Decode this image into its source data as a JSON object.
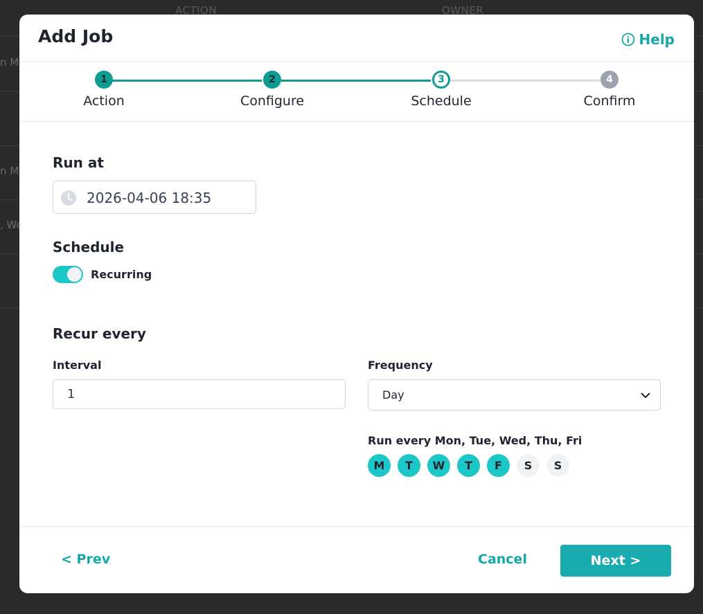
{
  "background": {
    "columns": [
      "ACTION",
      "OWNER"
    ],
    "row_fragments": [
      "n M",
      "",
      "n M",
      ", We"
    ]
  },
  "modal": {
    "title": "Add Job",
    "help_label": "Help",
    "help_icon": "info-circle-icon"
  },
  "stepper": {
    "steps": [
      {
        "number": "1",
        "label": "Action",
        "state": "done"
      },
      {
        "number": "2",
        "label": "Configure",
        "state": "done"
      },
      {
        "number": "3",
        "label": "Schedule",
        "state": "current"
      },
      {
        "number": "4",
        "label": "Confirm",
        "state": "todo"
      }
    ]
  },
  "form": {
    "run_at_title": "Run at",
    "run_at_value": "2026-04-06 18:35",
    "schedule_title": "Schedule",
    "recurring_label": "Recurring",
    "recurring_on": true,
    "recur_every_title": "Recur every",
    "interval_label": "Interval",
    "interval_value": "1",
    "frequency_label": "Frequency",
    "frequency_value": "Day",
    "run_every_text": "Run every Mon, Tue, Wed, Thu, Fri",
    "days": [
      {
        "letter": "M",
        "on": true
      },
      {
        "letter": "T",
        "on": true
      },
      {
        "letter": "W",
        "on": true
      },
      {
        "letter": "T",
        "on": true
      },
      {
        "letter": "F",
        "on": true
      },
      {
        "letter": "S",
        "on": false
      },
      {
        "letter": "S",
        "on": false
      }
    ]
  },
  "footer": {
    "prev_label": "< Prev",
    "cancel_label": "Cancel",
    "next_label": "Next >"
  },
  "colors": {
    "accent": "#17a7a7",
    "step_done": "#0e9b91",
    "toggle_on": "#1ec7c7",
    "next_button": "#19acae"
  }
}
